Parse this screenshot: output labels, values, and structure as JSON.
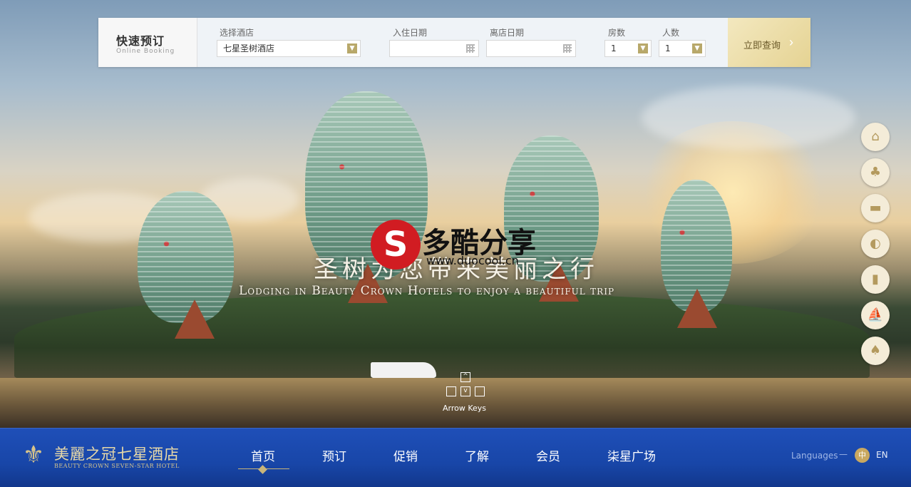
{
  "booking": {
    "title_cn": "快速预订",
    "title_en": "Online Booking",
    "hotel_label": "选择酒店",
    "hotel_value": "七星圣树酒店",
    "checkin_label": "入住日期",
    "checkin_value": "",
    "checkout_label": "离店日期",
    "checkout_value": "",
    "rooms_label": "房数",
    "rooms_value": "1",
    "guests_label": "人数",
    "guests_value": "1",
    "submit_label": "立即查询",
    "submit_arrow": "›"
  },
  "hero": {
    "slogan_cn": "圣树为您带来美丽之行",
    "slogan_en": "Lodging in Beauty Crown Hotels to enjoy a beautiful trip",
    "watermark_name": "多酷分享",
    "watermark_url": "www.duocool.cn",
    "watermark_glyph": "S"
  },
  "arrow_keys": {
    "label": "Arrow Keys",
    "up": "^",
    "left": "",
    "down": "v",
    "right": ""
  },
  "side_nav": {
    "icons": [
      "home-icon",
      "tree-icon",
      "bed-icon",
      "dining-icon",
      "bottles-icon",
      "boat-icon",
      "crown-icon"
    ]
  },
  "footer": {
    "logo_cn": "美麗之冠七星酒店",
    "logo_en": "BEAUTY CROWN SEVEN-STAR HOTEL",
    "nav": [
      {
        "label": "首页"
      },
      {
        "label": "预订"
      },
      {
        "label": "促销"
      },
      {
        "label": "了解"
      },
      {
        "label": "会员"
      },
      {
        "label": "柒星广场"
      }
    ],
    "languages_label": "Languages",
    "lang_dash": "—",
    "lang_cn": "中",
    "lang_en": "EN"
  },
  "colors": {
    "footer_bg": "#1846a8",
    "accent_gold": "#c9b57a",
    "submit_bg": "#e5d393"
  }
}
